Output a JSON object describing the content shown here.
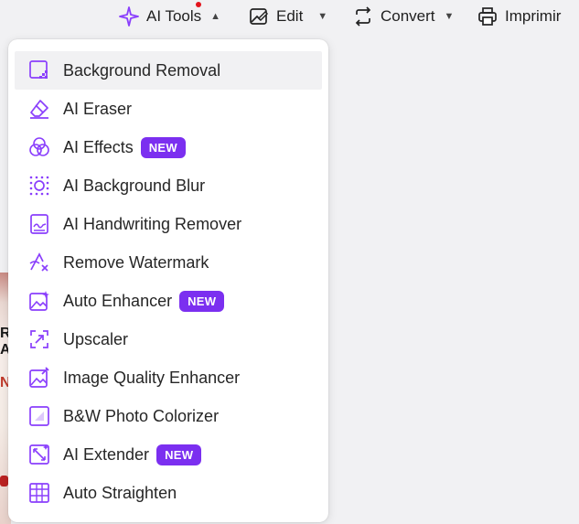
{
  "toolbar": {
    "ai_tools_label": "AI Tools",
    "edit_label": "Edit",
    "convert_label": "Convert",
    "print_label": "Imprimir"
  },
  "menu": {
    "items": [
      {
        "label": "Background Removal",
        "icon": "background-removal-icon"
      },
      {
        "label": "AI Eraser",
        "icon": "eraser-icon"
      },
      {
        "label": "AI Effects",
        "icon": "effects-icon",
        "badge": "NEW"
      },
      {
        "label": "AI Background Blur",
        "icon": "background-blur-icon"
      },
      {
        "label": "AI Handwriting Remover",
        "icon": "handwriting-remover-icon"
      },
      {
        "label": "Remove Watermark",
        "icon": "remove-watermark-icon"
      },
      {
        "label": "Auto Enhancer",
        "icon": "auto-enhancer-icon",
        "badge": "NEW"
      },
      {
        "label": "Upscaler",
        "icon": "upscaler-icon"
      },
      {
        "label": "Image Quality Enhancer",
        "icon": "image-quality-enhancer-icon"
      },
      {
        "label": "B&W Photo Colorizer",
        "icon": "photo-colorizer-icon"
      },
      {
        "label": "AI Extender",
        "icon": "extender-icon",
        "badge": "NEW"
      },
      {
        "label": "Auto Straighten",
        "icon": "auto-straighten-icon"
      }
    ]
  },
  "colors": {
    "accent": "#8a3ffc",
    "badge": "#7b2ff0",
    "notification_dot": "#e3141c"
  }
}
